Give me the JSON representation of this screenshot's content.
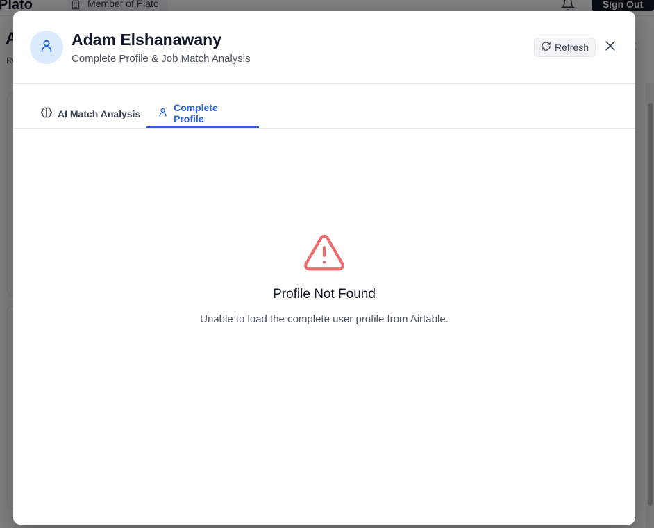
{
  "background": {
    "logo": "Plato",
    "member_label": "Member of Plato",
    "signout_label": "Sign Out",
    "page_title_initial": "A",
    "page_sub_initial": "Re"
  },
  "modal": {
    "user_name": "Adam Elshanawany",
    "subtitle": "Complete Profile & Job Match Analysis",
    "refresh_label": "Refresh",
    "tabs": [
      {
        "label": "AI Match Analysis",
        "icon": "brain-icon",
        "active": false
      },
      {
        "label": "Complete Profile",
        "icon": "user-icon",
        "active": true
      }
    ],
    "error": {
      "icon": "warning-triangle-icon",
      "title": "Profile Not Found",
      "description": "Unable to load the complete user profile from Airtable."
    }
  },
  "colors": {
    "accent": "#2563eb",
    "avatar_bg": "#dbeafe",
    "error_icon": "#ef6b6b",
    "overlay": "rgba(0,0,0,0.5)"
  }
}
